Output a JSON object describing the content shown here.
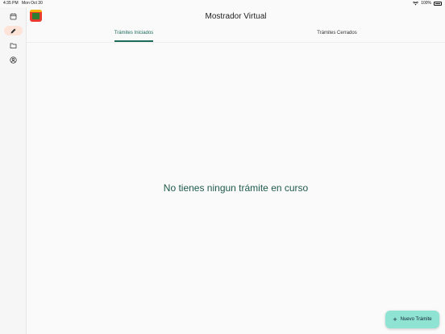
{
  "status_bar": {
    "time": "4:35 PM",
    "date": "Mon Oct 30",
    "battery": "100%"
  },
  "sidebar": {
    "items": [
      {
        "icon": "calendar-icon",
        "active": false
      },
      {
        "icon": "pencil-icon",
        "active": true
      },
      {
        "icon": "folder-icon",
        "active": false
      },
      {
        "icon": "user-circle-icon",
        "active": false
      }
    ]
  },
  "header": {
    "title": "Mostrador Virtual",
    "tabs": [
      {
        "label": "Trámites Iniciados",
        "active": true
      },
      {
        "label": "Trámites Cerrados",
        "active": false
      }
    ]
  },
  "main": {
    "empty_message": "No tienes ningun trámite en curso"
  },
  "fab": {
    "label": "Nuevo Trámite"
  },
  "colors": {
    "accent": "#1f6b5a",
    "fab_background": "#8fe3d3",
    "active_sidebar": "#fde3d8"
  }
}
